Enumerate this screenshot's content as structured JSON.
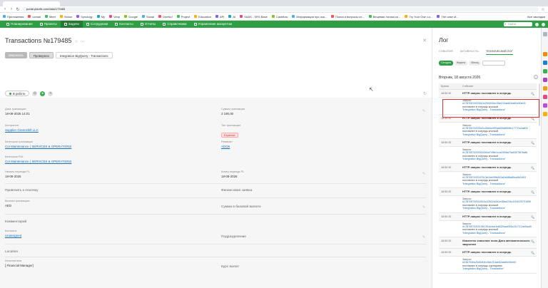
{
  "browser": {
    "url": "portal.planfix.com/task/179485",
    "bookmarks": [
      "Приложения",
      "ucmail",
      "Meet",
      "Stolon",
      "Synology",
      "My",
      "Vimp",
      "Google",
      "Social",
      "OneNo!",
      "Project",
      "Education",
      "API",
      "AI",
      "SAAS - SRS Base",
      "Cashflow",
      "Информация про ока...",
      "Психа и вопросы сл...",
      "Вещевая логика ко...",
      "Try Your Own Lo...",
      "The case of..."
    ],
    "bookmarks_right": "Все закладки"
  },
  "topnav": {
    "items": [
      {
        "label": "Планирование",
        "icon": "calendar-icon"
      },
      {
        "label": "Проекты",
        "icon": "folder-icon"
      },
      {
        "label": "Задачи",
        "icon": "tasks-icon",
        "active": true
      },
      {
        "label": "Сотрудники",
        "icon": "people-icon"
      },
      {
        "label": "Контакты",
        "icon": "contacts-icon"
      },
      {
        "label": "Отчеты",
        "icon": "reports-icon"
      },
      {
        "label": "Справочники",
        "icon": "book-icon"
      },
      {
        "label": "Управление аккаунтом",
        "icon": "gear-icon"
      }
    ],
    "search_placeholder": "Найти"
  },
  "task": {
    "title": "Transactions №179485",
    "stage_prev": "Запросить",
    "stage_current": "Проверено",
    "flow": "Integration BigQuery - Transactions",
    "status": "В работе"
  },
  "fields": {
    "date_label": "Дата транзакции",
    "date_value": "18-08-2026 14:01",
    "sum_label": "Сумма транзакции",
    "sum_value": "2 190,00",
    "counterparty_label": "Контрагент",
    "counterparty_value": "Supplier Greenshift LLC",
    "type_label": "Тип транзакции",
    "type_value": "Expense",
    "category_label": "Категория транзакции",
    "category_value": "Cor Maintenance ( SERVICES & OPERATIONS",
    "account_label": "Реквизит",
    "account_value": "ADCB",
    "pnl_label": "Категория P&L",
    "pnl_value": "Cor Maintenance ( SERVICES & OPERATIONS",
    "period_start_label": "Начало периода PL",
    "period_start_value": "18-08-2026",
    "period_end_label": "Конец периода PL",
    "period_end_value": "18-08-2026",
    "payment_plan_label": "Привязать к платежу",
    "finance_link_label": "Финансовая заявка",
    "currency_sum_label": "Сумма в базовой валюте",
    "pay_currency_label": "Валюта транзакции",
    "pay_currency_value": "AED",
    "comment_label": "Комментарий",
    "contacts_label": "Контакты",
    "contacts_value": "Unassigned",
    "division_label": "Подразделение",
    "location_label": "Location",
    "executor_label": "Исполнители",
    "executor_value": "[ Financial Manager]",
    "rate_label": "Курс валют"
  },
  "log": {
    "title": "Лог",
    "tabs": [
      "СОБЫТИЯ",
      "АКТИВНОСТЬ",
      "ТЕХНИЧЕСКИЙ ЛОГ"
    ],
    "filters": [
      "Сегодня",
      "Неделя",
      "Месяц"
    ],
    "date_heading": "Вторник, 18 августа 2026",
    "col_time": "Время",
    "col_event": "Событие",
    "rows": [
      {
        "time": "18:50:30",
        "title": "HTTP-запрос поставлен в очередь"
      },
      {
        "time": "",
        "label": "Запрос:",
        "link": "#17870574f23510c254540ec36e213ae82da80c50e00",
        "text": "поставлен в очередь кнопкой",
        "bind": "\"Integration BigQuery - Transactions\""
      },
      {
        "time": "18:50:30",
        "title": "HTTP-запрос поставлен в очередь"
      },
      {
        "time": "",
        "label": "Запрос:",
        "link": "#17870574f33540c30b0c9f53ab09d8908b17770c2a800",
        "text": "поставлен в очередь кнопкой",
        "bind": "\"Integration BigQuery - Transactions\""
      },
      {
        "time": "18:50:30",
        "title": "HTTP-запрос поставлен в очередь"
      },
      {
        "time": "",
        "label": "Запрос:",
        "link": "#17870574f3352c0b0d74f8e1ccc059ba75a5307f87fa8b",
        "text": "поставлен в очередь кнопкой",
        "bind": "\"Integration BigQuery - Transactions\""
      },
      {
        "time": "18:50:30",
        "title": "HTTP-запрос поставлен в очередь"
      },
      {
        "time": "",
        "label": "Запрос:",
        "link": "#17870574f3347513e1be09fb842a0e8f8a80ca5b3493",
        "text": "поставлен в очередь кнопкой",
        "bind": "\"Integration BigQuery - Transactions\""
      },
      {
        "time": "18:50:30",
        "title": "HTTP-запрос поставлен в очередь"
      },
      {
        "time": "",
        "label": "Запрос:",
        "link": "#17870574f334543c32832a3b1e46ba234c1f3d2257f7d0f0",
        "text": "поставлен в очередь кнопкой",
        "bind": "\"Integration BigQuery - Transactions\""
      },
      {
        "time": "18:50:30",
        "title": "HTTP-запрос поставлен в очередь"
      },
      {
        "time": "",
        "label": "Запрос:",
        "link": "#17870574f3313613f1dcba1bd632baa005c22c717afd0ad0",
        "text": "поставлен в очередь кнопкой",
        "bind": "\"Integration BigQuery - Transactions\""
      },
      {
        "time": "18:50:30",
        "title": "Изменено значение поля Дата автоматического закрытия"
      },
      {
        "time": "18:50:30",
        "title": "HTTP-запрос поставлен в очередь"
      },
      {
        "time": "",
        "label": "Запрос:",
        "link": "#236793bc254540ec36e213ae82da80c50e00",
        "text": "поставлен в очередь сценарием",
        "bind": "\"Integration BigQuery - Transaction\""
      }
    ]
  },
  "colors": {
    "brand_green": "#2f9e44",
    "link_blue": "#1b6fb5",
    "highlight_red": "#e03131"
  }
}
